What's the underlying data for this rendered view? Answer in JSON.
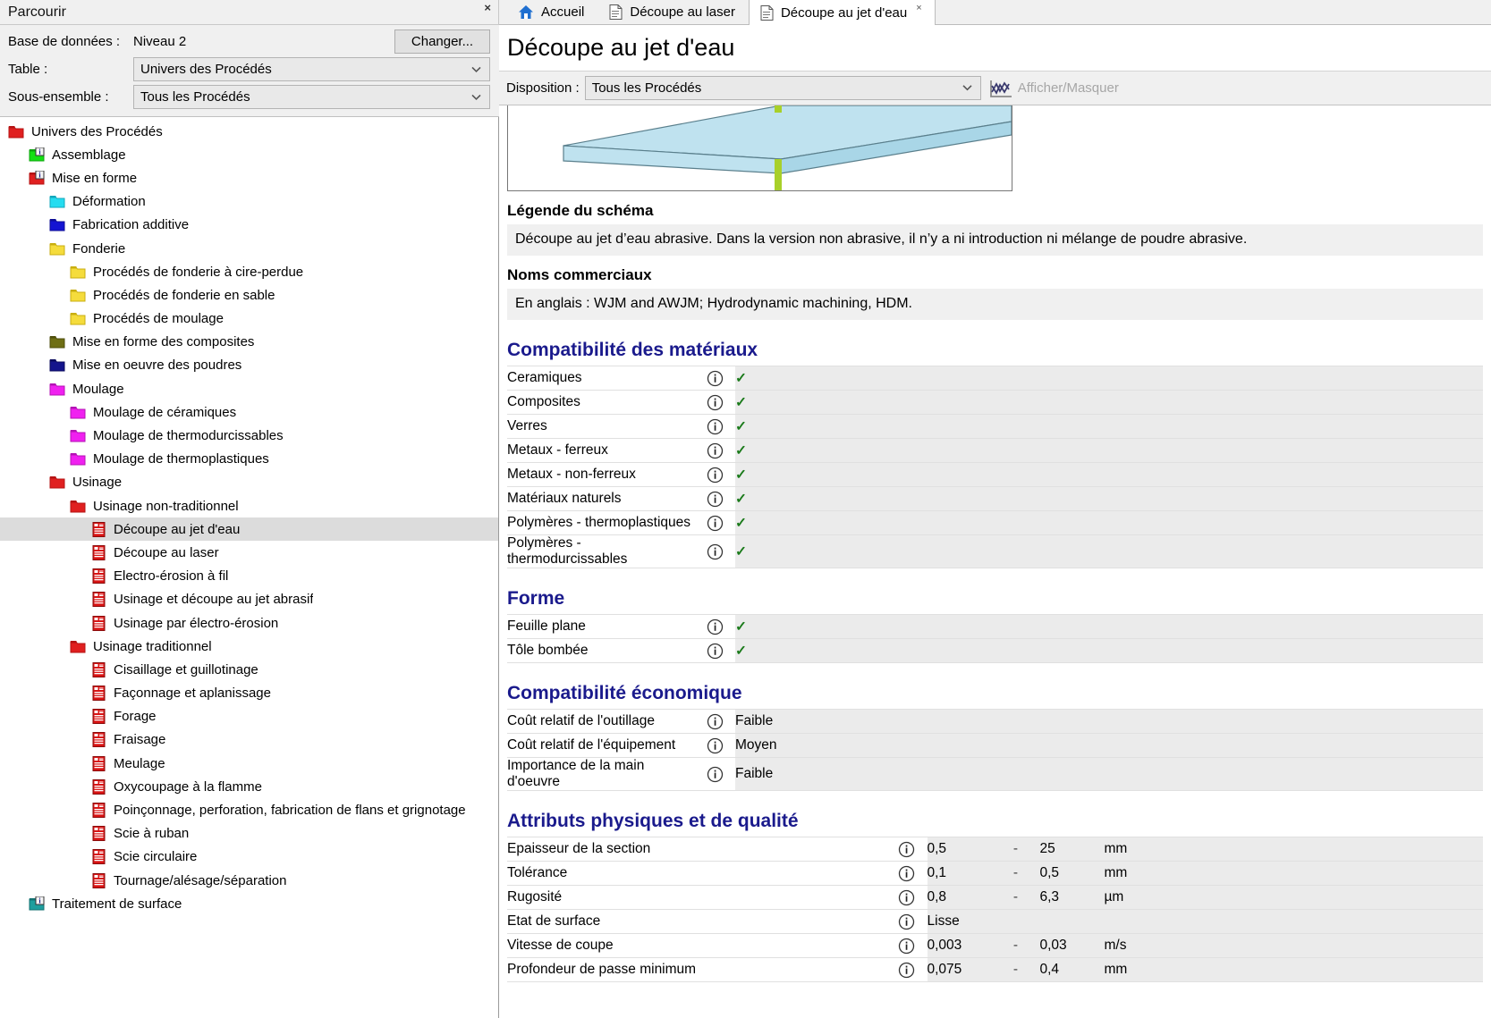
{
  "browse": {
    "title": "Parcourir",
    "close_label": "×",
    "db_label": "Base de données :",
    "db_value": "Niveau 2",
    "change_button": "Changer...",
    "table_label": "Table :",
    "table_value": "Univers des Procédés",
    "subset_label": "Sous-ensemble :",
    "subset_value": "Tous les Procédés"
  },
  "tree": {
    "items": [
      {
        "label": "Univers des Procédés",
        "depth": 0,
        "icon": "folder-red",
        "selected": false
      },
      {
        "label": "Assemblage",
        "depth": 1,
        "icon": "folder-green-info",
        "selected": false
      },
      {
        "label": "Mise en forme",
        "depth": 1,
        "icon": "folder-red-info",
        "selected": false
      },
      {
        "label": "Déformation",
        "depth": 2,
        "icon": "folder-cyan",
        "selected": false
      },
      {
        "label": "Fabrication additive",
        "depth": 2,
        "icon": "folder-blue",
        "selected": false
      },
      {
        "label": "Fonderie",
        "depth": 2,
        "icon": "folder-yellow",
        "selected": false
      },
      {
        "label": "Procédés de fonderie à cire-perdue",
        "depth": 3,
        "icon": "folder-yellow",
        "selected": false
      },
      {
        "label": "Procédés de fonderie en sable",
        "depth": 3,
        "icon": "folder-yellow",
        "selected": false
      },
      {
        "label": "Procédés de moulage",
        "depth": 3,
        "icon": "folder-yellow",
        "selected": false
      },
      {
        "label": "Mise en forme des composites",
        "depth": 2,
        "icon": "folder-olive",
        "selected": false
      },
      {
        "label": "Mise en oeuvre des poudres",
        "depth": 2,
        "icon": "folder-navy",
        "selected": false
      },
      {
        "label": "Moulage",
        "depth": 2,
        "icon": "folder-magenta",
        "selected": false
      },
      {
        "label": "Moulage de céramiques",
        "depth": 3,
        "icon": "folder-magenta",
        "selected": false
      },
      {
        "label": "Moulage de thermodurcissables",
        "depth": 3,
        "icon": "folder-magenta",
        "selected": false
      },
      {
        "label": "Moulage de thermoplastiques",
        "depth": 3,
        "icon": "folder-magenta",
        "selected": false
      },
      {
        "label": "Usinage",
        "depth": 2,
        "icon": "folder-red",
        "selected": false
      },
      {
        "label": "Usinage non-traditionnel",
        "depth": 3,
        "icon": "folder-red",
        "selected": false
      },
      {
        "label": "Découpe au jet d'eau",
        "depth": 4,
        "icon": "record-red",
        "selected": true
      },
      {
        "label": "Découpe au laser",
        "depth": 4,
        "icon": "record-red",
        "selected": false
      },
      {
        "label": "Electro-érosion à fil",
        "depth": 4,
        "icon": "record-red",
        "selected": false
      },
      {
        "label": "Usinage et découpe au jet abrasif",
        "depth": 4,
        "icon": "record-red",
        "selected": false
      },
      {
        "label": "Usinage par électro-érosion",
        "depth": 4,
        "icon": "record-red",
        "selected": false
      },
      {
        "label": "Usinage traditionnel",
        "depth": 3,
        "icon": "folder-red",
        "selected": false
      },
      {
        "label": "Cisaillage et guillotinage",
        "depth": 4,
        "icon": "record-red",
        "selected": false
      },
      {
        "label": "Façonnage et aplanissage",
        "depth": 4,
        "icon": "record-red",
        "selected": false
      },
      {
        "label": "Forage",
        "depth": 4,
        "icon": "record-red",
        "selected": false
      },
      {
        "label": "Fraisage",
        "depth": 4,
        "icon": "record-red",
        "selected": false
      },
      {
        "label": "Meulage",
        "depth": 4,
        "icon": "record-red",
        "selected": false
      },
      {
        "label": "Oxycoupage à la flamme",
        "depth": 4,
        "icon": "record-red",
        "selected": false
      },
      {
        "label": "Poinçonnage, perforation, fabrication de flans et grignotage",
        "depth": 4,
        "icon": "record-red",
        "selected": false
      },
      {
        "label": "Scie à ruban",
        "depth": 4,
        "icon": "record-red",
        "selected": false
      },
      {
        "label": "Scie circulaire",
        "depth": 4,
        "icon": "record-red",
        "selected": false
      },
      {
        "label": "Tournage/alésage/séparation",
        "depth": 4,
        "icon": "record-red",
        "selected": false
      },
      {
        "label": "Traitement de surface",
        "depth": 1,
        "icon": "folder-teal-info",
        "selected": false
      }
    ]
  },
  "tabs": [
    {
      "label": "Accueil",
      "icon": "home-icon",
      "active": false,
      "closable": false
    },
    {
      "label": "Découpe au laser",
      "icon": "document-icon",
      "active": false,
      "closable": false
    },
    {
      "label": "Découpe au jet d'eau",
      "icon": "document-icon",
      "active": true,
      "closable": true,
      "close_label": "×"
    }
  ],
  "document": {
    "title": "Découpe au jet d'eau",
    "disposition_label": "Disposition :",
    "disposition_value": "Tous les Procédés",
    "show_hide_label": "Afficher/Masquer",
    "legend_heading": "Légende du schéma",
    "legend_text": "Découpe au jet d’eau abrasive. Dans la version non abrasive, il n’y a ni introduction ni mélange de poudre abrasive.",
    "trade_heading": "Noms commerciaux",
    "trade_text": "En anglais : WJM and AWJM; Hydrodynamic machining, HDM."
  },
  "sections": [
    {
      "heading": "Compatibilité des matériaux",
      "rows": [
        {
          "name": "Ceramiques",
          "kind": "check",
          "value": "✓"
        },
        {
          "name": "Composites",
          "kind": "check",
          "value": "✓"
        },
        {
          "name": "Verres",
          "kind": "check",
          "value": "✓"
        },
        {
          "name": "Metaux - ferreux",
          "kind": "check",
          "value": "✓"
        },
        {
          "name": "Metaux - non-ferreux",
          "kind": "check",
          "value": "✓"
        },
        {
          "name": "Matériaux naturels",
          "kind": "check",
          "value": "✓"
        },
        {
          "name": "Polymères - thermoplastiques",
          "kind": "check",
          "value": "✓"
        },
        {
          "name": "Polymères - thermodurcissables",
          "kind": "check",
          "value": "✓"
        }
      ]
    },
    {
      "heading": "Forme",
      "rows": [
        {
          "name": "Feuille plane",
          "kind": "check",
          "value": "✓"
        },
        {
          "name": "Tôle bombée",
          "kind": "check",
          "value": "✓"
        }
      ]
    },
    {
      "heading": "Compatibilité économique",
      "rows": [
        {
          "name": "Coût relatif de l'outillage",
          "kind": "text",
          "value": "Faible"
        },
        {
          "name": "Coût relatif de l'équipement",
          "kind": "text",
          "value": "Moyen"
        },
        {
          "name": "Importance de la main d'oeuvre",
          "kind": "text",
          "value": "Faible"
        }
      ]
    },
    {
      "heading": "Attributs physiques et de qualité",
      "rows": [
        {
          "name": "Epaisseur de la section",
          "kind": "range",
          "min": "0,5",
          "dash": "-",
          "max": "25",
          "unit": "mm"
        },
        {
          "name": "Tolérance",
          "kind": "range",
          "min": "0,1",
          "dash": "-",
          "max": "0,5",
          "unit": "mm"
        },
        {
          "name": "Rugosité",
          "kind": "range",
          "min": "0,8",
          "dash": "-",
          "max": "6,3",
          "unit": "µm"
        },
        {
          "name": "Etat de surface",
          "kind": "text",
          "value": "Lisse"
        },
        {
          "name": "Vitesse de coupe",
          "kind": "range",
          "min": "0,003",
          "dash": "-",
          "max": "0,03",
          "unit": "m/s"
        },
        {
          "name": "Profondeur de passe minimum",
          "kind": "range",
          "min": "0,075",
          "dash": "-",
          "max": "0,4",
          "unit": "mm"
        }
      ]
    }
  ],
  "colors": {
    "heading_blue": "#1a1a8c",
    "check_green": "#1a7a1a",
    "value_bg": "#ebebeb",
    "selection_grey": "#dcdcdc",
    "chrome_grey": "#f0f0f0"
  }
}
